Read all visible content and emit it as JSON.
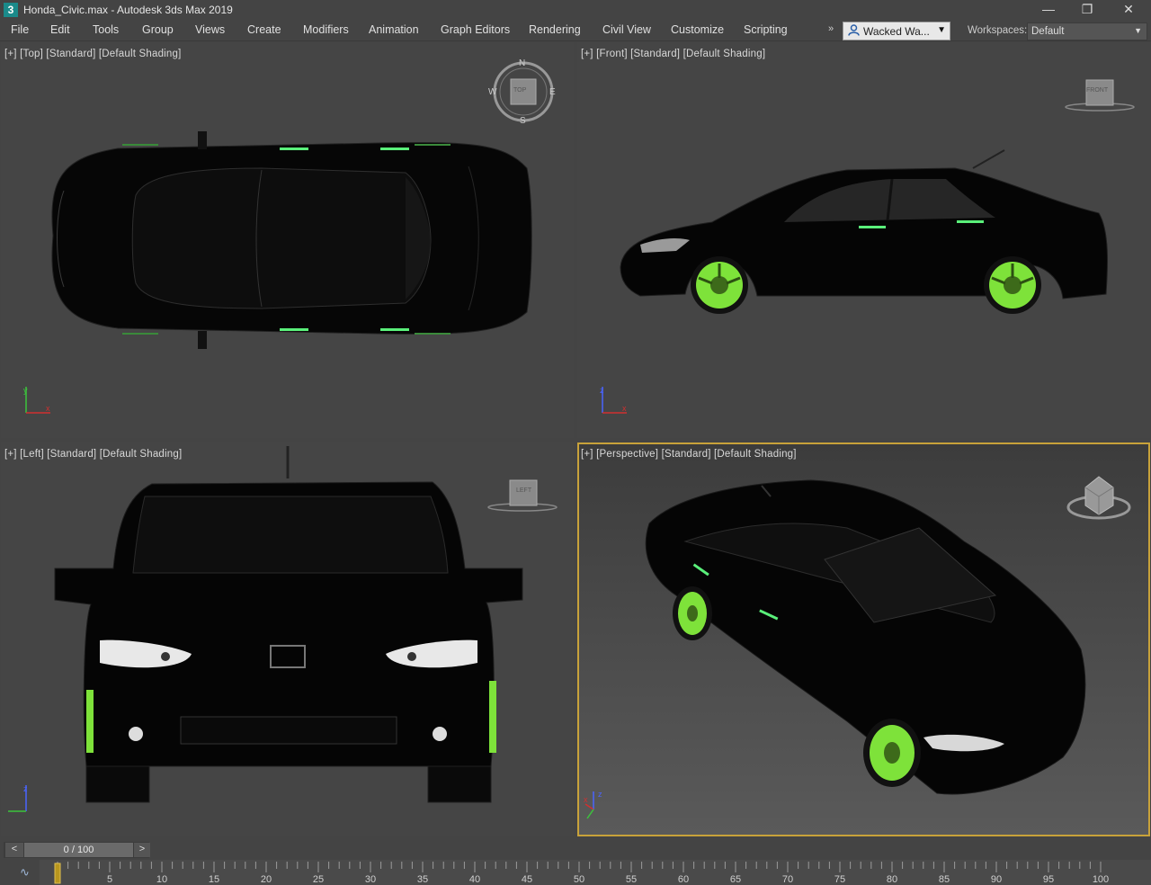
{
  "window": {
    "title": "Honda_Civic.max - Autodesk 3ds Max 2019",
    "app_icon": "3",
    "min_glyph": "—",
    "restore_glyph": "❐",
    "close_glyph": "✕"
  },
  "menu": {
    "items": [
      "File",
      "Edit",
      "Tools",
      "Group",
      "Views",
      "Create",
      "Modifiers",
      "Animation",
      "Graph Editors",
      "Rendering",
      "Civil View",
      "Customize",
      "Scripting"
    ],
    "overflow_glyph": "»"
  },
  "user": {
    "name": "Wacked Wa...",
    "icon": "user-icon"
  },
  "workspaces": {
    "label": "Workspaces:",
    "value": "Default"
  },
  "viewports": {
    "top": {
      "label": "[+] [Top] [Standard] [Default Shading]",
      "compass": {
        "n": "N",
        "s": "S",
        "e": "E",
        "w": "W",
        "face": "TOP"
      }
    },
    "front": {
      "label": "[+] [Front] [Standard] [Default Shading]",
      "cube_face": "FRONT"
    },
    "left": {
      "label": "[+] [Left] [Standard] [Default Shading]",
      "cube_face": "LEFT"
    },
    "perspective": {
      "label": "[+] [Perspective] [Standard] [Default Shading]",
      "active": true
    }
  },
  "colors": {
    "wheel_green": "#7ee23a",
    "accent_green": "#5af07a",
    "active_border": "#c8a23a",
    "axis_x": "#d23030",
    "axis_y": "#3cc43c",
    "axis_z": "#4a64ff"
  },
  "timeline": {
    "current": "0 / 100",
    "prev_glyph": "<",
    "next_glyph": ">",
    "ticks": [
      5,
      10,
      15,
      20,
      25,
      30,
      35,
      40,
      45,
      50,
      55,
      60,
      65,
      70,
      75,
      80,
      85,
      90,
      95,
      100
    ],
    "frame_start": 0,
    "frame_end": 100
  }
}
